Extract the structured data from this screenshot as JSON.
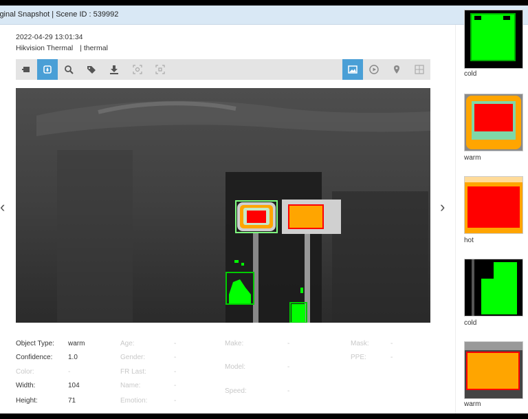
{
  "titlebar": {
    "text": "iginal Snapshot | Scene ID : 539992"
  },
  "header": {
    "timestamp": "2022-04-29 13:01:34",
    "camera": "Hikvision Thermal",
    "mode": "| thermal"
  },
  "toolbar": {
    "left_icons": [
      "export-icon",
      "thermal-icon",
      "search-icon",
      "tag-icon",
      "download-icon",
      "detect-face-icon",
      "detect-object-icon"
    ],
    "right_icons": [
      "image-icon",
      "play-icon",
      "location-icon",
      "grid-icon"
    ]
  },
  "details": {
    "object_type_label": "Object Type:",
    "object_type": "warm",
    "confidence_label": "Confidence:",
    "confidence": "1.0",
    "color_label": "Color:",
    "color": "-",
    "width_label": "Width:",
    "width": "104",
    "height_label": "Height:",
    "height": "71",
    "age_label": "Age:",
    "age": "-",
    "gender_label": "Gender:",
    "gender": "-",
    "fr_last_label": "FR Last:",
    "fr_last": "-",
    "name_label": "Name:",
    "name": "-",
    "emotion_label": "Emotion:",
    "emotion": "-",
    "make_label": "Make:",
    "make": "-",
    "model_label": "Model:",
    "model": "-",
    "speed_label": "Speed:",
    "speed": "-",
    "mask_label": "Mask:",
    "mask": "-",
    "ppe_label": "PPE:",
    "ppe": "-"
  },
  "thumbnails": [
    {
      "label": "cold"
    },
    {
      "label": "warm"
    },
    {
      "label": "hot"
    },
    {
      "label": "cold"
    },
    {
      "label": "warm"
    }
  ],
  "colors": {
    "accent": "#4a9fd6",
    "cold": "#00ff00",
    "warm": "#ffa500",
    "hot": "#ff0000"
  }
}
